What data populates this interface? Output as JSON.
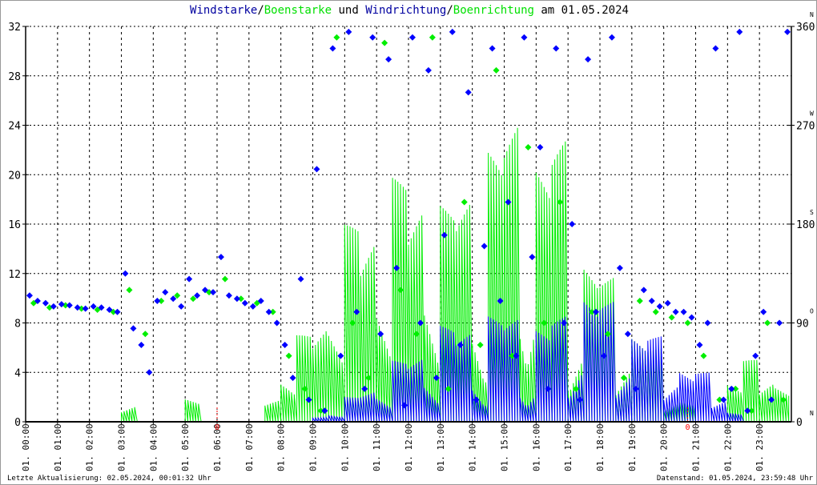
{
  "title": {
    "part1": "Windstarke",
    "sep1": "/",
    "part2": "Boenstarke",
    "mid": " und ",
    "part3": "Windrichtung",
    "sep2": "/",
    "part4": "Boenrichtung",
    "end": " am 01.05.2024"
  },
  "footer": {
    "left": "Letzte Aktualisierung: 02.05.2024, 00:01:32 Uhr",
    "right": "Datenstand: 01.05.2024, 23:59:48 Uhr"
  },
  "colors": {
    "wind": "#0000ff",
    "gust": "#00ee00",
    "marker": "#ff0000",
    "grid": "#000000"
  },
  "chart_data": {
    "type": "line+scatter",
    "title": "Windstarke/Boenstarke und Windrichtung/Boenrichtung am 01.05.2024",
    "ylim_left": [
      0,
      32
    ],
    "yticks_left": [
      "0",
      "4",
      "8",
      "12",
      "16",
      "20",
      "24",
      "28",
      "32"
    ],
    "ylim_right": [
      0,
      360
    ],
    "yticks_right": [
      {
        "value": "0",
        "dir": "N"
      },
      {
        "value": "90",
        "dir": "O"
      },
      {
        "value": "180",
        "dir": "S"
      },
      {
        "value": "270",
        "dir": "W"
      },
      {
        "value": "360",
        "dir": "N"
      }
    ],
    "xlim_hours": [
      0,
      24
    ],
    "xticks": [
      "01. 00:00",
      "01. 01:00",
      "01. 02:00",
      "01. 03:00",
      "01. 04:00",
      "01. 05:00",
      "01. 06:00",
      "01. 07:00",
      "01. 08:00",
      "01. 09:00",
      "01. 10:00",
      "01. 11:00",
      "01. 12:00",
      "01. 13:00",
      "01. 14:00",
      "01. 15:00",
      "01. 16:00",
      "01. 17:00",
      "01. 18:00",
      "01. 19:00",
      "01. 20:00",
      "01. 21:00",
      "01. 22:00",
      "01. 23:00"
    ],
    "grid": true,
    "markers": [
      {
        "hour": 6.0,
        "label": "0"
      },
      {
        "hour": 20.75,
        "label": "0"
      }
    ],
    "series": [
      {
        "name": "Windstarke",
        "kind": "line",
        "axis": "left",
        "step_hours": 0.5,
        "values": [
          0,
          0,
          0,
          0,
          0,
          0,
          0,
          0,
          0,
          0,
          0,
          0,
          0,
          0,
          0,
          0,
          0,
          0,
          0.5,
          1,
          2,
          3,
          4,
          5,
          6,
          7,
          8,
          8,
          8,
          9,
          9,
          8,
          8,
          9,
          12,
          11,
          10,
          9,
          8,
          7,
          6,
          5,
          4,
          3,
          1,
          0,
          0,
          0
        ]
      },
      {
        "name": "Boenstarke",
        "kind": "line",
        "axis": "left",
        "step_hours": 0.5,
        "values": [
          0,
          0,
          0,
          0,
          0,
          0,
          2.5,
          0,
          0,
          0,
          2.5,
          0,
          0,
          0,
          0,
          2.5,
          5,
          7,
          10,
          13,
          16,
          18,
          18,
          20,
          20,
          22,
          18,
          20,
          20,
          23,
          26,
          28,
          22,
          24,
          15,
          14,
          12,
          10,
          8,
          6,
          3,
          2,
          0,
          0,
          4,
          5,
          5,
          4
        ]
      },
      {
        "name": "Windrichtung",
        "kind": "scatter",
        "axis": "right",
        "step_hours": 0.25,
        "values": [
          115,
          110,
          108,
          105,
          107,
          106,
          104,
          103,
          105,
          104,
          102,
          100,
          135,
          85,
          70,
          45,
          110,
          118,
          112,
          105,
          130,
          115,
          120,
          118,
          150,
          115,
          112,
          108,
          105,
          110,
          100,
          90,
          70,
          40,
          130,
          20,
          230,
          10,
          340,
          60,
          355,
          100,
          30,
          350,
          80,
          330,
          140,
          15,
          350,
          90,
          320,
          40,
          170,
          355,
          70,
          300,
          20,
          160,
          340,
          110,
          200,
          60,
          350,
          150,
          250,
          30,
          340,
          90,
          180,
          20,
          330,
          100,
          60,
          350,
          140,
          80,
          30,
          120,
          110,
          105,
          108,
          100,
          100,
          95,
          70,
          90,
          340,
          20,
          30,
          355,
          10,
          60,
          100,
          20,
          90,
          355
        ]
      },
      {
        "name": "Boenrichtung",
        "kind": "scatter",
        "axis": "right",
        "step_hours": 0.5,
        "values": [
          108,
          104,
          106,
          103,
          102,
          100,
          120,
          80,
          110,
          115,
          112,
          118,
          130,
          112,
          108,
          100,
          60,
          30,
          10,
          350,
          90,
          40,
          345,
          120,
          80,
          350,
          30,
          200,
          70,
          320,
          60,
          250,
          90,
          200,
          30,
          100,
          80,
          40,
          110,
          100,
          95,
          90,
          60,
          20,
          30,
          10,
          90,
          20
        ]
      }
    ]
  }
}
